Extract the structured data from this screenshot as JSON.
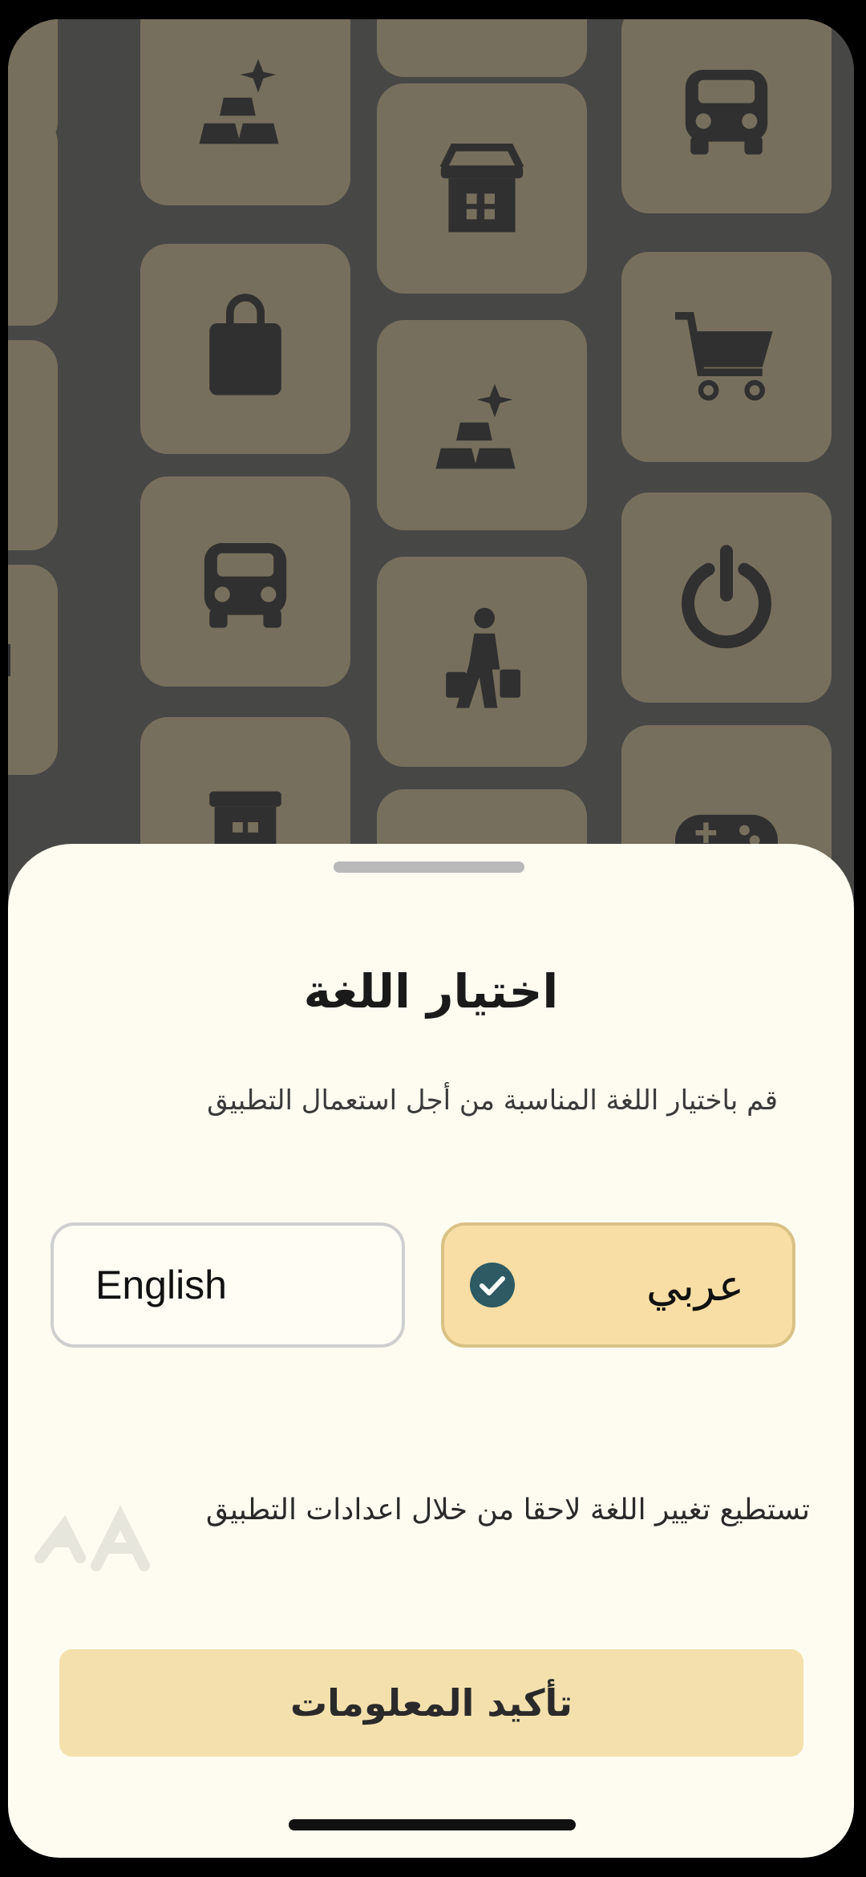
{
  "sheet": {
    "title": "اختيار اللغة",
    "subtitle": "قم باختيار اللغة المناسبة من أجل استعمال التطبيق",
    "options": [
      {
        "label": "English",
        "selected": false
      },
      {
        "label": "عربي",
        "selected": true
      }
    ],
    "hint": "تستطيع تغيير اللغة لاحقا من خلال اعدادات التطبيق",
    "confirm_label": "تأكيد المعلومات"
  },
  "background_icons": [
    "gold-bars-icon",
    "store-icon",
    "car-icon",
    "shopper-icon",
    "shopping-bag-icon",
    "shopping-cart-icon",
    "power-icon",
    "gamepad-icon"
  ],
  "colors": {
    "tile": "#d8c394",
    "sheet": "#fefcf0",
    "selected_option": "#f8dea4",
    "check": "#2d5a63",
    "confirm_button": "#f3e0ac"
  }
}
